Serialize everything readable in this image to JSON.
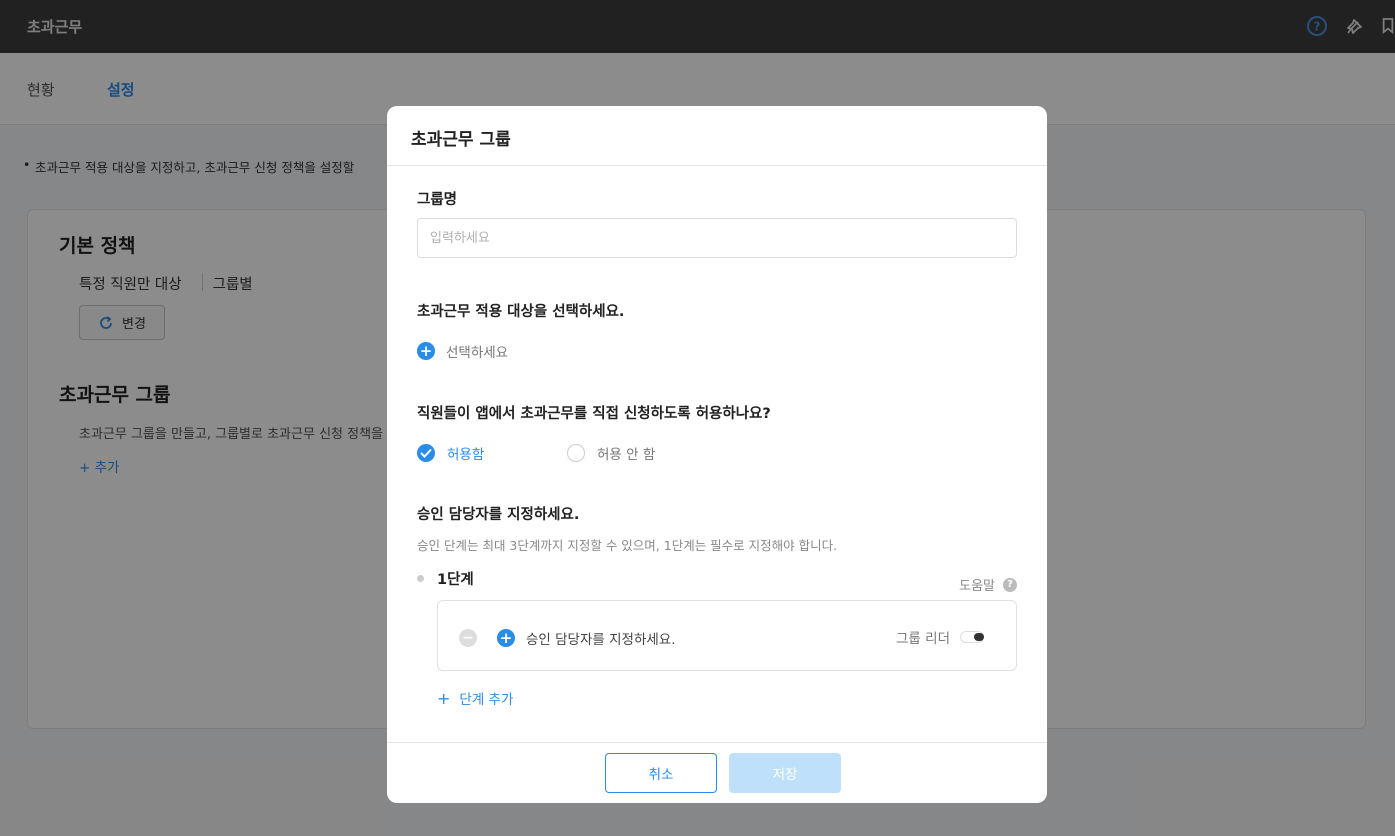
{
  "app": {
    "title": "초과근무"
  },
  "tabs": [
    {
      "label": "현황"
    },
    {
      "label": "설정"
    }
  ],
  "page": {
    "note": "초과근무 적용 대상을 지정하고, 초과근무 신청 정책을 설정할",
    "basic_policy": {
      "title": "기본 정책",
      "target_label": "특정 직원만 대상",
      "mode_label": "그룹별",
      "change_button": "변경"
    },
    "groups": {
      "title": "초과근무 그룹",
      "description": "초과근무 그룹을 만들고, 그룹별로 초과근무 신청 정책을",
      "add_link": "+ 추가"
    }
  },
  "modal": {
    "title": "초과근무 그룹",
    "group_name": {
      "label": "그룹명",
      "placeholder": "입력하세요",
      "value": ""
    },
    "target": {
      "question": "초과근무 적용 대상을 선택하세요.",
      "select_label": "선택하세요"
    },
    "app_request": {
      "question": "직원들이 앱에서 초과근무를 직접 신청하도록 허용하나요?",
      "options": [
        {
          "label": "허용함",
          "selected": true
        },
        {
          "label": "허용 안 함",
          "selected": false
        }
      ]
    },
    "approver": {
      "question": "승인 담당자를 지정하세요.",
      "hint": "승인 단계는 최대 3단계까지 지정할 수 있으며, 1단계는 필수로 지정해야 합니다.",
      "step_title": "1단계",
      "help_label": "도움말",
      "assign_label": "승인 담당자를 지정하세요.",
      "leader_label": "그룹 리더",
      "leader_toggle": "on",
      "add_step": "단계 추가"
    },
    "footer": {
      "cancel": "취소",
      "save": "저장"
    }
  },
  "colors": {
    "accent": "#2a8be8",
    "topbar": "#3d3d3d",
    "save_disabled": "#bfe0fb"
  }
}
